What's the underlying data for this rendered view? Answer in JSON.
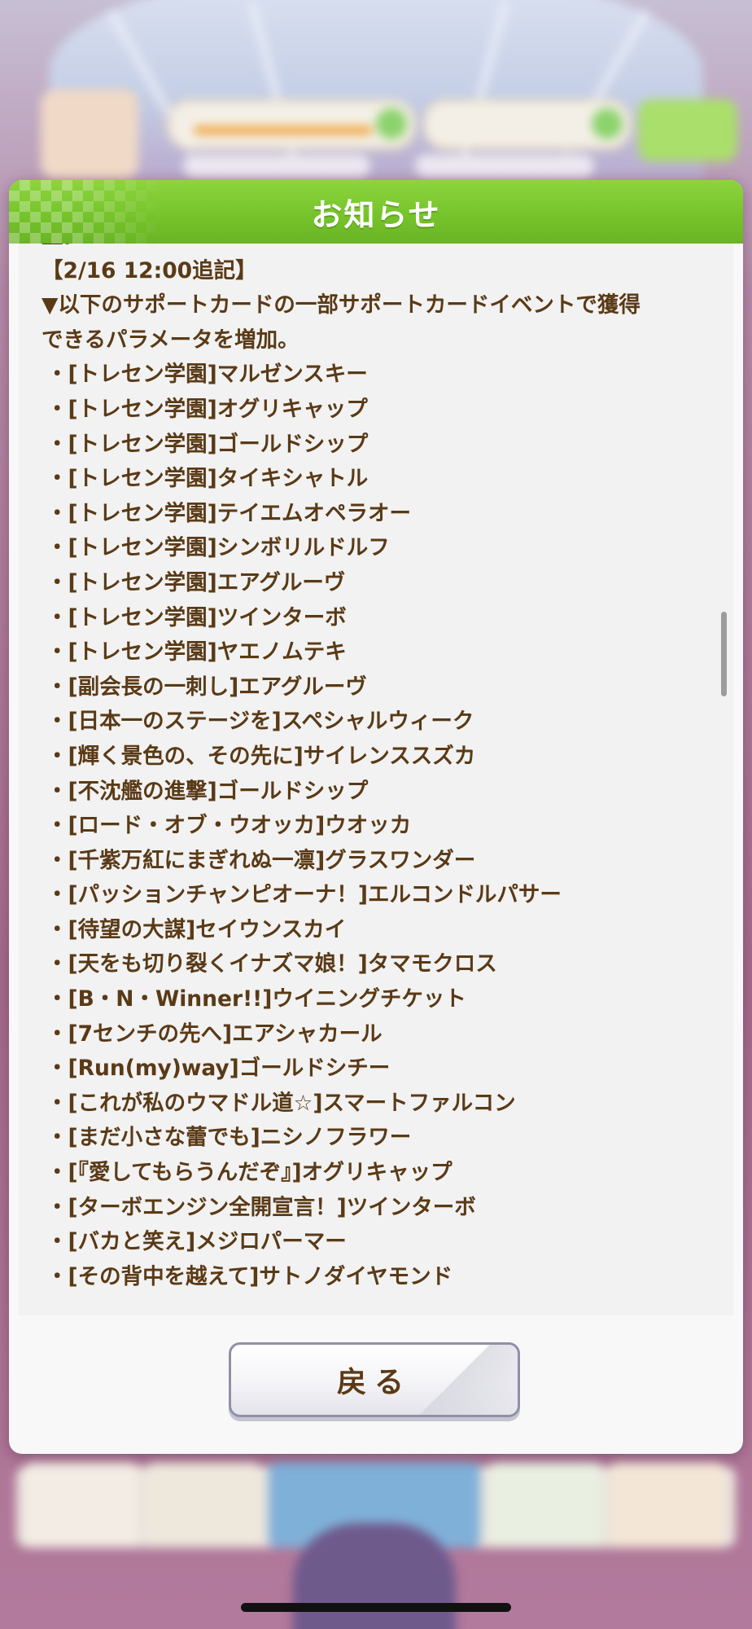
{
  "dialog": {
    "title": "お知らせ",
    "back_label": "戻る"
  },
  "notice": {
    "lines": [
      "量。",
      "【2/16 12:00追記】",
      "▼以下のサポートカードの一部サポートカードイベントで獲得",
      "できるパラメータを増加。",
      "・[トレセン学園]マルゼンスキー",
      "・[トレセン学園]オグリキャップ",
      "・[トレセン学園]ゴールドシップ",
      "・[トレセン学園]タイキシャトル",
      "・[トレセン学園]テイエムオペラオー",
      "・[トレセン学園]シンボリルドルフ",
      "・[トレセン学園]エアグルーヴ",
      "・[トレセン学園]ツインターボ",
      "・[トレセン学園]ヤエノムテキ",
      "・[副会長の一刺し]エアグルーヴ",
      "・[日本一のステージを]スペシャルウィーク",
      "・[輝く景色の、その先に]サイレンススズカ",
      "・[不沈艦の進撃]ゴールドシップ",
      "・[ロード・オブ・ウオッカ]ウオッカ",
      "・[千紫万紅にまぎれぬ一凛]グラスワンダー",
      "・[パッションチャンピオーナ！]エルコンドルパサー",
      "・[待望の大謀]セイウンスカイ",
      "・[天をも切り裂くイナズマ娘！]タマモクロス",
      "・[B・N・Winner!!]ウイニングチケット",
      "・[7センチの先へ]エアシャカール",
      "・[Run(my)way]ゴールドシチー",
      "・[これが私のウマドル道☆]スマートファルコン",
      "・[まだ小さな蕾でも]ニシノフラワー",
      "・[『愛してもらうんだぞ』]オグリキャップ",
      "・[ターボエンジン全開宣言！]ツインターボ",
      "・[バカと笑え]メジロパーマー",
      "・[その背中を越えて]サトノダイヤモンド"
    ]
  },
  "colors": {
    "header_green": "#76c42b",
    "text_brown": "#5a3a16",
    "panel_bg": "#f2f2f2"
  }
}
